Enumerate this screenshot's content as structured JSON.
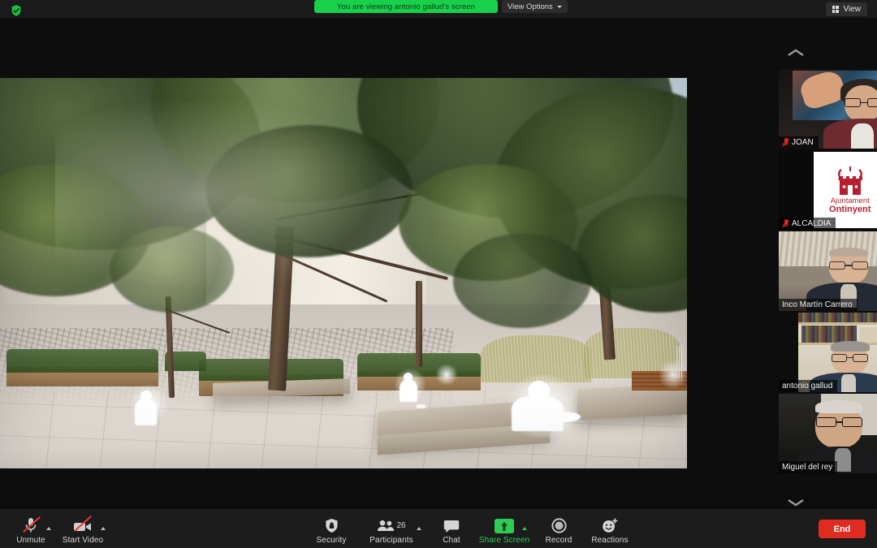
{
  "topbar": {
    "encryption_icon": "shield-check-icon",
    "sharing_banner": "You are viewing antonio gallud's screen",
    "view_options_label": "View Options",
    "view_options_icon": "chevron-down-icon",
    "view_button_label": "View",
    "view_button_icon": "grid-icon",
    "banner_color": "#19d04b"
  },
  "share_stage": {
    "content_description": "Architectural rendering of a public plaza with large trees, concrete benches, planters and white silhouette figures",
    "resize_handle_icon": "drag-handle-icon"
  },
  "filmstrip": {
    "scroll_up_icon": "chevron-up-icon",
    "scroll_down_icon": "chevron-down-icon",
    "active_border_color": "#cddc39",
    "participants": [
      {
        "name": "JOAN",
        "muted": true,
        "active": false
      },
      {
        "name": "ALCALDIA",
        "muted": true,
        "active": false,
        "logo_line1": "Ajuntament",
        "logo_line2": "Ontinyent"
      },
      {
        "name": "Inco Martín Carrero",
        "muted": false,
        "active": false
      },
      {
        "name": "antonio gallud",
        "muted": false,
        "active": true
      },
      {
        "name": "Miguel del rey",
        "muted": false,
        "active": false
      }
    ]
  },
  "toolbar": {
    "audio": {
      "label": "Unmute",
      "icon": "microphone-muted-icon",
      "caret_icon": "chevron-up-icon",
      "muted": true
    },
    "video": {
      "label": "Start Video",
      "icon": "camera-muted-icon",
      "caret_icon": "chevron-up-icon",
      "muted": true
    },
    "security": {
      "label": "Security",
      "icon": "shield-icon"
    },
    "participants": {
      "label": "Participants",
      "icon": "people-icon",
      "count": "26",
      "caret_icon": "chevron-up-icon"
    },
    "chat": {
      "label": "Chat",
      "icon": "chat-bubble-icon"
    },
    "share_screen": {
      "label": "Share Screen",
      "icon": "share-screen-icon",
      "active": true,
      "color": "#2ecc55",
      "caret_icon": "chevron-up-icon"
    },
    "record": {
      "label": "Record",
      "icon": "record-circle-icon"
    },
    "reactions": {
      "label": "Reactions",
      "icon": "smiley-plus-icon"
    },
    "end": {
      "label": "End",
      "color": "#e02b20"
    }
  }
}
